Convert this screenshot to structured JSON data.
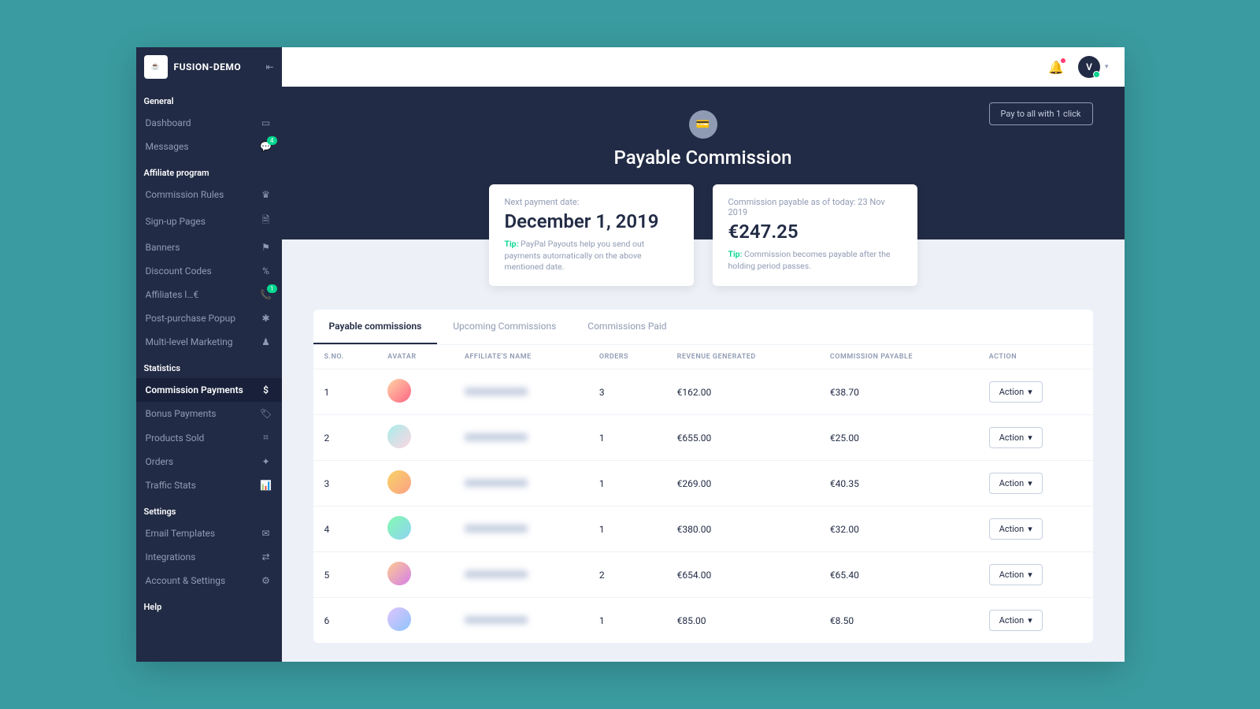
{
  "brand": {
    "name": "FUSION-DEMO",
    "logo_text": "☕"
  },
  "topbar": {
    "avatar_initial": "V"
  },
  "sidebar": {
    "sections": [
      {
        "title": "General",
        "items": [
          {
            "label": "Dashboard",
            "icon": "▭"
          },
          {
            "label": "Messages",
            "icon": "💬",
            "badge": "4"
          }
        ]
      },
      {
        "title": "Affiliate program",
        "items": [
          {
            "label": "Commission Rules",
            "icon": "♛"
          },
          {
            "label": "Sign-up Pages",
            "icon": "🗎"
          },
          {
            "label": "Banners",
            "icon": "⚑"
          },
          {
            "label": "Discount Codes",
            "icon": "%"
          },
          {
            "label": "Affiliates l…€",
            "icon": "📞",
            "badge": "1"
          },
          {
            "label": "Post-purchase Popup",
            "icon": "✱"
          },
          {
            "label": "Multi-level Marketing",
            "icon": "♟"
          }
        ]
      },
      {
        "title": "Statistics",
        "items": [
          {
            "label": "Commission Payments",
            "icon": "$",
            "active": true
          },
          {
            "label": "Bonus Payments",
            "icon": "🏷"
          },
          {
            "label": "Products Sold",
            "icon": "⌗"
          },
          {
            "label": "Orders",
            "icon": "✦"
          },
          {
            "label": "Traffic Stats",
            "icon": "📊"
          }
        ]
      },
      {
        "title": "Settings",
        "items": [
          {
            "label": "Email Templates",
            "icon": "✉"
          },
          {
            "label": "Integrations",
            "icon": "⇄"
          },
          {
            "label": "Account & Settings",
            "icon": "⚙"
          }
        ]
      },
      {
        "title": "Help",
        "items": []
      }
    ]
  },
  "hero": {
    "title": "Payable Commission",
    "pay_all_label": "Pay to all with 1 click"
  },
  "cards": {
    "next_payment": {
      "label": "Next payment date:",
      "value": "December 1, 2019",
      "tip_prefix": "Tip:",
      "tip_text": " PayPal Payouts help you send out payments automatically on the above mentioned date."
    },
    "payable": {
      "label": "Commission payable as of today: 23 Nov 2019",
      "value": "€247.25",
      "tip_prefix": "Tip:",
      "tip_text": " Commission becomes payable after the holding period passes."
    }
  },
  "tabs": [
    {
      "label": "Payable commissions",
      "active": true
    },
    {
      "label": "Upcoming Commissions"
    },
    {
      "label": "Commissions Paid"
    }
  ],
  "table": {
    "headers": [
      "S.NO.",
      "AVATAR",
      "AFFILIATE'S NAME",
      "ORDERS",
      "REVENUE GENERATED",
      "COMMISSION PAYABLE",
      "ACTION"
    ],
    "action_label": "Action",
    "rows": [
      {
        "sno": "1",
        "orders": "3",
        "revenue": "€162.00",
        "commission": "€38.70"
      },
      {
        "sno": "2",
        "orders": "1",
        "revenue": "€655.00",
        "commission": "€25.00"
      },
      {
        "sno": "3",
        "orders": "1",
        "revenue": "€269.00",
        "commission": "€40.35"
      },
      {
        "sno": "4",
        "orders": "1",
        "revenue": "€380.00",
        "commission": "€32.00"
      },
      {
        "sno": "5",
        "orders": "2",
        "revenue": "€654.00",
        "commission": "€65.40"
      },
      {
        "sno": "6",
        "orders": "1",
        "revenue": "€85.00",
        "commission": "€8.50"
      }
    ]
  }
}
